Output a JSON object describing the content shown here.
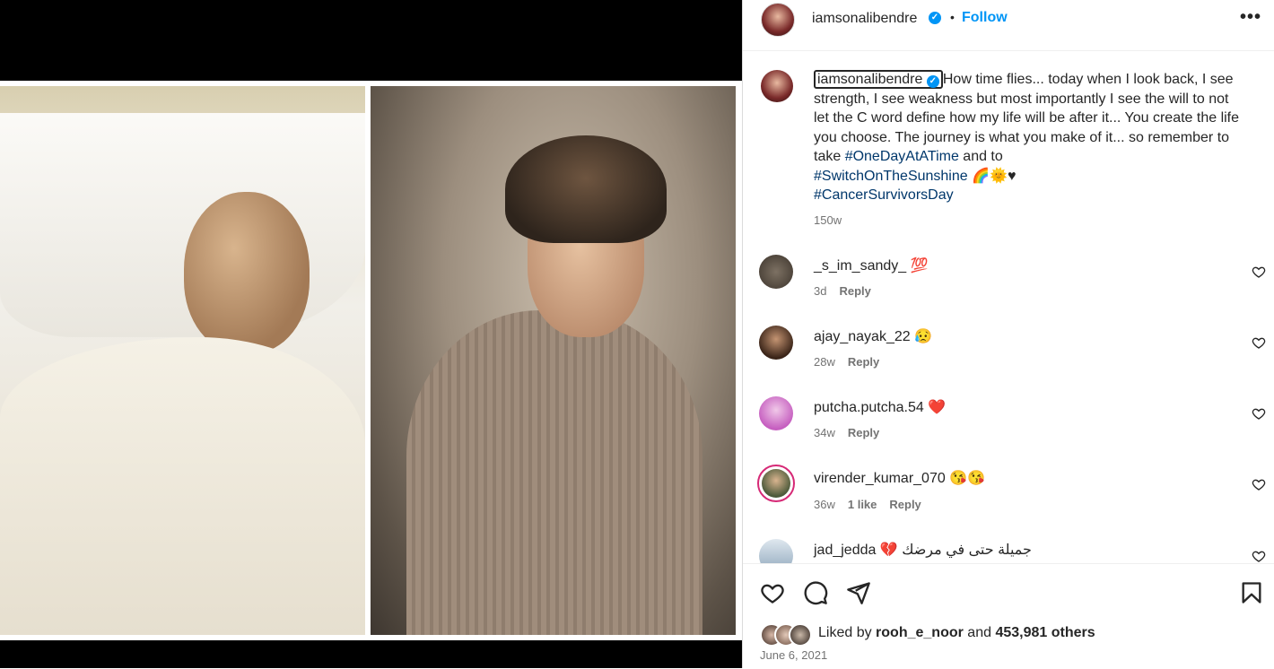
{
  "header": {
    "username": "iamsonalibendre",
    "verified_icon": "verified-badge-icon",
    "separator": "•",
    "follow_label": "Follow",
    "more_label": "•••"
  },
  "caption": {
    "username": "iamsonalibendre",
    "text_1": "How time flies... today when I look back, I see strength, I see weakness but most importantly I see the will to not let the C word define how my life will be after it... You create the life you choose. The journey is what you make of it... so remember to take ",
    "hashtag_1": "#OneDayAtATime",
    "text_2": " and to ",
    "hashtag_2": "#SwitchOnTheSunshine",
    "emojis": "🌈🌞♥",
    "hashtag_3": "#CancerSurvivorsDay",
    "time": "150w"
  },
  "comments": [
    {
      "username": "_s_im_sandy_",
      "text": "💯",
      "time": "3d",
      "likes": "",
      "reply": "Reply"
    },
    {
      "username": "ajay_nayak_22",
      "text": "😥",
      "time": "28w",
      "likes": "",
      "reply": "Reply"
    },
    {
      "username": "putcha.putcha.54",
      "text": "❤️",
      "time": "34w",
      "likes": "",
      "reply": "Reply"
    },
    {
      "username": "virender_kumar_070",
      "text": "😘😘",
      "time": "36w",
      "likes": "1 like",
      "reply": "Reply"
    },
    {
      "username": "jad_jedda",
      "text": "💔 جميلة حتى في مرضك",
      "time": "",
      "likes": "",
      "reply": ""
    }
  ],
  "likes": {
    "prefix": "Liked by ",
    "user": "rooh_e_noor",
    "middle": " and ",
    "count": "453,981 others"
  },
  "post_date": "June 6, 2021",
  "icons": [
    "heart-icon",
    "comment-icon",
    "share-icon",
    "bookmark-icon"
  ]
}
